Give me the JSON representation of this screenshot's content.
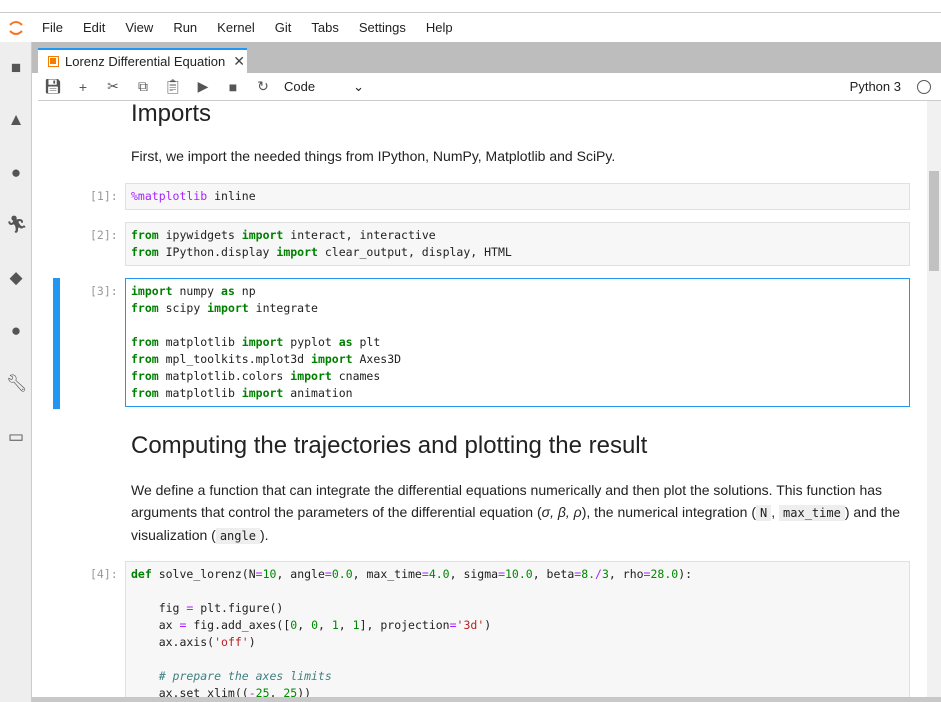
{
  "menu": [
    "File",
    "Edit",
    "View",
    "Run",
    "Kernel",
    "Git",
    "Tabs",
    "Settings",
    "Help"
  ],
  "tab": {
    "title": "Lorenz Differential Equation",
    "close": "✕"
  },
  "toolbar": {
    "cell_type": "Code",
    "kernel": "Python 3"
  },
  "sidebar_icons": [
    "folder-icon",
    "google-drive-icon",
    "github-icon",
    "running-icon",
    "git-icon",
    "palette-icon",
    "wrench-icon",
    "tabs-icon"
  ],
  "notebook": {
    "h_imports": "Imports",
    "p_imports": "First, we import the needed things from IPython, NumPy, Matplotlib and SciPy.",
    "h_compute": "Computing the trajectories and plotting the result",
    "p_compute_1": "We define a function that can integrate the differential equations numerically and then plot the solutions. This function has arguments that control the parameters of the differential equation (",
    "p_compute_greek": "σ, β, ρ",
    "p_compute_2": "), the numerical integration (",
    "p_code_N": "N",
    "p_comma": ",",
    "p_code_maxtime": "max_time",
    "p_compute_3": ") and the visualization (",
    "p_code_angle": "angle",
    "p_compute_4": ").",
    "cells": [
      {
        "prompt": "[1]:",
        "lines": [
          [
            [
              "%matplotlib",
              "m"
            ],
            [
              " inline",
              ""
            ]
          ]
        ]
      },
      {
        "prompt": "[2]:",
        "lines": [
          [
            [
              "from",
              "k"
            ],
            [
              " ipywidgets ",
              ""
            ],
            [
              "import",
              "k"
            ],
            [
              " interact, interactive",
              ""
            ]
          ],
          [
            [
              "from",
              "k"
            ],
            [
              " IPython.display ",
              ""
            ],
            [
              "import",
              "k"
            ],
            [
              " clear_output, display, HTML",
              ""
            ]
          ]
        ]
      },
      {
        "prompt": "[3]:",
        "lines": [
          [
            [
              "import",
              "k"
            ],
            [
              " numpy ",
              ""
            ],
            [
              "as",
              "k"
            ],
            [
              " np",
              ""
            ]
          ],
          [
            [
              "from",
              "k"
            ],
            [
              " scipy ",
              ""
            ],
            [
              "import",
              "k"
            ],
            [
              " integrate",
              ""
            ]
          ],
          [],
          [
            [
              "from",
              "k"
            ],
            [
              " matplotlib ",
              ""
            ],
            [
              "import",
              "k"
            ],
            [
              " pyplot ",
              ""
            ],
            [
              "as",
              "k"
            ],
            [
              " plt",
              ""
            ]
          ],
          [
            [
              "from",
              "k"
            ],
            [
              " mpl_toolkits.mplot3d ",
              ""
            ],
            [
              "import",
              "k"
            ],
            [
              " Axes3D",
              ""
            ]
          ],
          [
            [
              "from",
              "k"
            ],
            [
              " matplotlib.colors ",
              ""
            ],
            [
              "import",
              "k"
            ],
            [
              " cnames",
              ""
            ]
          ],
          [
            [
              "from",
              "k"
            ],
            [
              " matplotlib ",
              ""
            ],
            [
              "import",
              "k"
            ],
            [
              " animation",
              ""
            ]
          ]
        ]
      },
      {
        "prompt": "[4]:",
        "lines": [
          [
            [
              "def",
              "k"
            ],
            [
              " solve_lorenz(N",
              ""
            ],
            [
              "=",
              "o"
            ],
            [
              "10",
              "n"
            ],
            [
              ", angle",
              ""
            ],
            [
              "=",
              "o"
            ],
            [
              "0.0",
              "n"
            ],
            [
              ", max_time",
              ""
            ],
            [
              "=",
              "o"
            ],
            [
              "4.0",
              "n"
            ],
            [
              ", sigma",
              ""
            ],
            [
              "=",
              "o"
            ],
            [
              "10.0",
              "n"
            ],
            [
              ", beta",
              ""
            ],
            [
              "=",
              "o"
            ],
            [
              "8.",
              "n"
            ],
            [
              "/",
              "o"
            ],
            [
              "3",
              "n"
            ],
            [
              ", rho",
              ""
            ],
            [
              "=",
              "o"
            ],
            [
              "28.0",
              "n"
            ],
            [
              "):",
              ""
            ]
          ],
          [],
          [
            [
              "    fig ",
              ""
            ],
            [
              "=",
              "o"
            ],
            [
              " plt.figure()",
              ""
            ]
          ],
          [
            [
              "    ax ",
              ""
            ],
            [
              "=",
              "o"
            ],
            [
              " fig.add_axes([",
              ""
            ],
            [
              "0",
              "n"
            ],
            [
              ", ",
              ""
            ],
            [
              "0",
              "n"
            ],
            [
              ", ",
              ""
            ],
            [
              "1",
              "n"
            ],
            [
              ", ",
              ""
            ],
            [
              "1",
              "n"
            ],
            [
              "], projection",
              ""
            ],
            [
              "=",
              "o"
            ],
            [
              "'3d'",
              "s"
            ],
            [
              ")",
              ""
            ]
          ],
          [
            [
              "    ax.axis(",
              ""
            ],
            [
              "'off'",
              "s"
            ],
            [
              ")",
              ""
            ]
          ],
          [],
          [
            [
              "    # prepare the axes limits",
              "c"
            ]
          ],
          [
            [
              "    ax.set_xlim((",
              ""
            ],
            [
              "-",
              "o"
            ],
            [
              "25",
              "n"
            ],
            [
              ", ",
              ""
            ],
            [
              "25",
              "n"
            ],
            [
              "))",
              ""
            ]
          ]
        ]
      }
    ]
  }
}
